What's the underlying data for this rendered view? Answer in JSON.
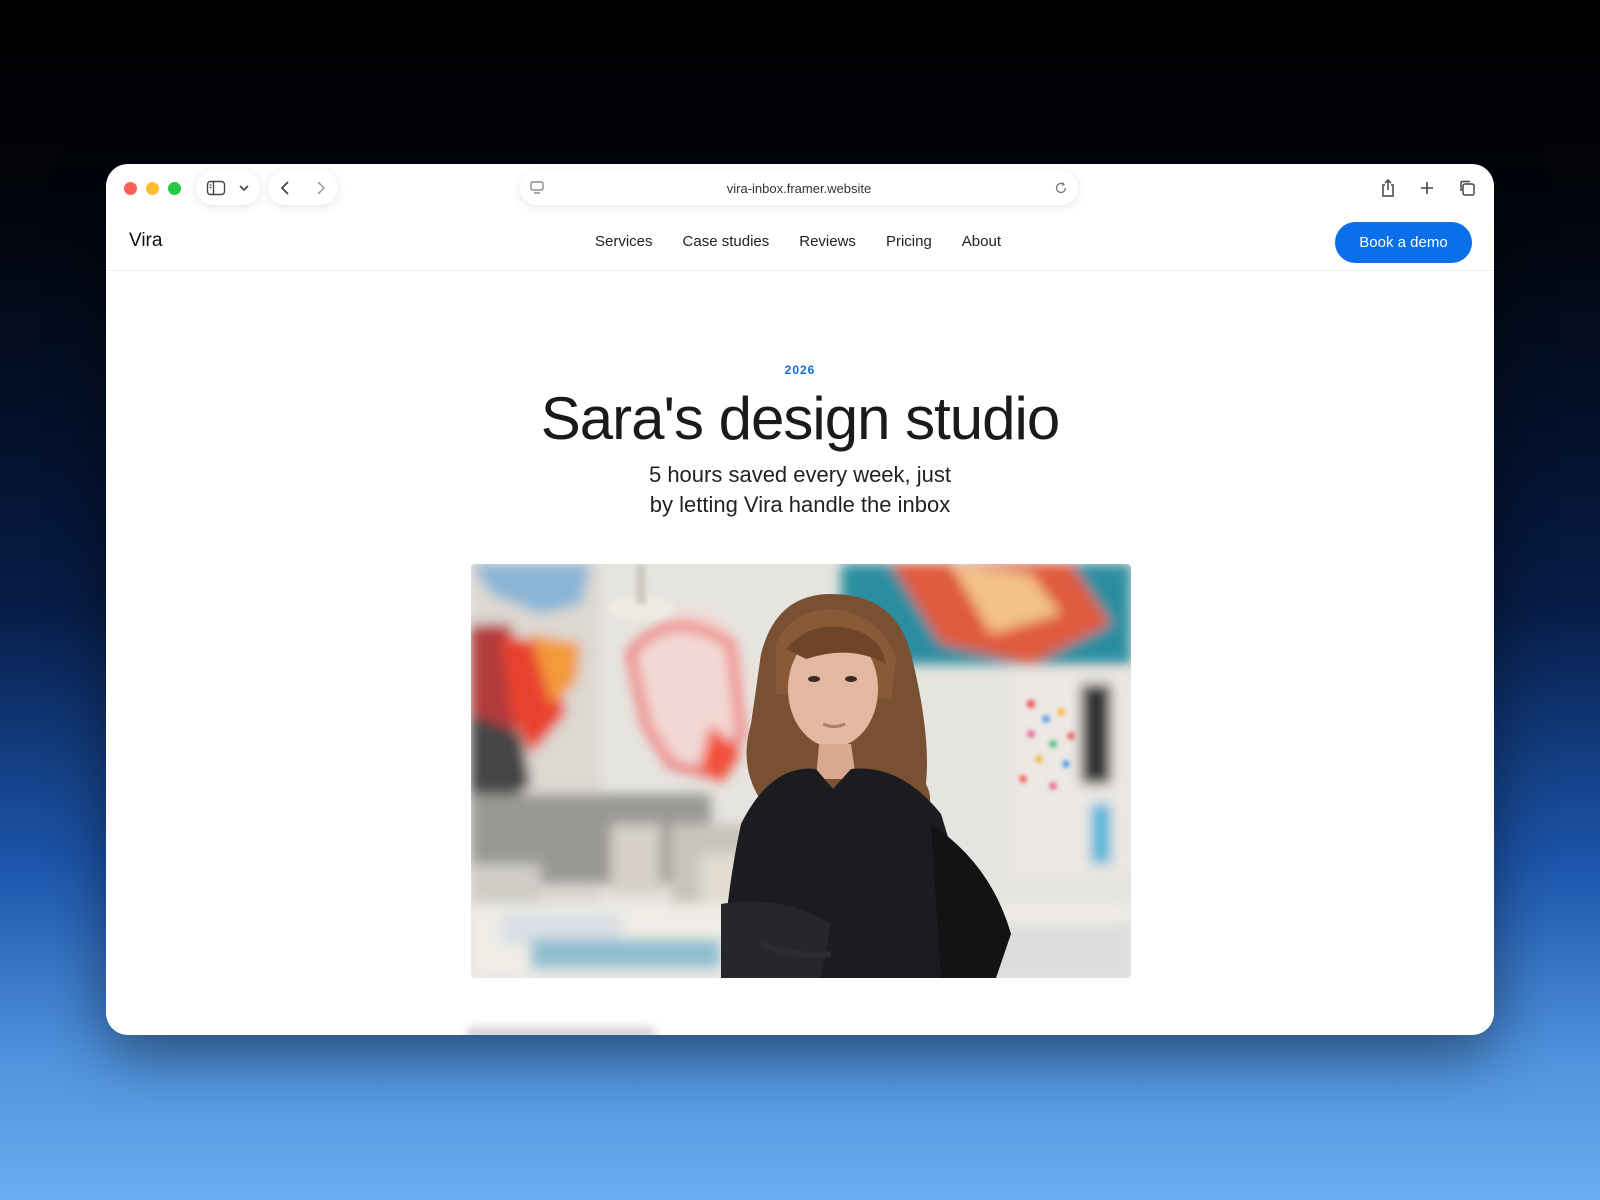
{
  "browser": {
    "url": "vira-inbox.framer.website"
  },
  "site": {
    "logo": "Vira",
    "nav": [
      "Services",
      "Case studies",
      "Reviews",
      "Pricing",
      "About"
    ],
    "cta": "Book a demo"
  },
  "hero": {
    "year": "2026",
    "title": "Sara's design studio",
    "subtitle_line1": "5 hours saved every week, just",
    "subtitle_line2": "by letting Vira handle the inbox"
  },
  "colors": {
    "accent": "#0a6fe8",
    "year": "#1769e0"
  },
  "icons": [
    "sidebar-icon",
    "chevron-down-icon",
    "back-icon",
    "forward-icon",
    "page-settings-icon",
    "reload-icon",
    "share-icon",
    "new-tab-icon",
    "tabs-overview-icon"
  ]
}
